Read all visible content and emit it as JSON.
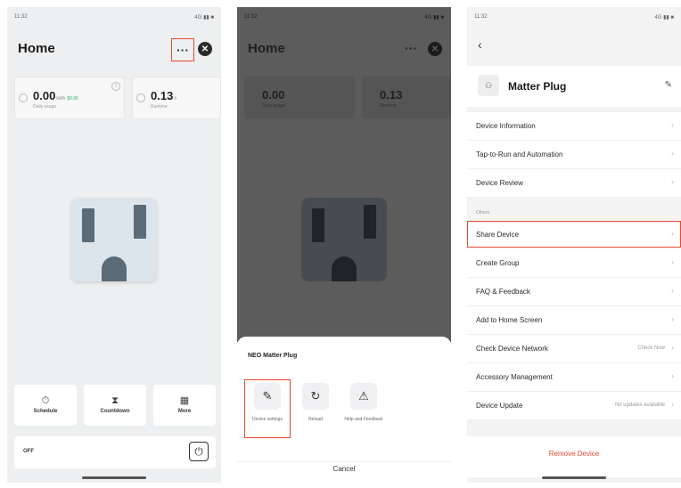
{
  "p1": {
    "status_time": "11:32",
    "status_icons": "4G ▮▮ ■",
    "title": "Home",
    "more_glyph": "···",
    "close_glyph": "✕",
    "stats": [
      {
        "value": "0.00",
        "unit": "kWh",
        "tag": "$0.00",
        "label": "Daily usage"
      },
      {
        "value": "0.13",
        "unit": "h",
        "tag": "",
        "label": "Runtime"
      }
    ],
    "info_glyph": "i",
    "actions": [
      {
        "icon": "⏱",
        "label": "Schedule"
      },
      {
        "icon": "⧗",
        "label": "Countdown"
      },
      {
        "icon": "▦",
        "label": "More"
      }
    ],
    "off_label": "OFF",
    "power_glyph": "⏻"
  },
  "p2": {
    "status_time": "11:32",
    "status_icons": "4G ▮▮ ■",
    "title": "Home",
    "more_glyph": "···",
    "close_glyph": "✕",
    "stats": [
      {
        "value": "0.00",
        "label": "Daily usage"
      },
      {
        "value": "0.13",
        "label": "Runtime"
      }
    ],
    "sheet_title": "NEO Matter Plug",
    "options": [
      {
        "icon": "✎",
        "label": "Device settings"
      },
      {
        "icon": "↻",
        "label": "Reload"
      },
      {
        "icon": "⚠",
        "label": "Help and Feedback"
      }
    ],
    "cancel": "Cancel"
  },
  "p3": {
    "status_time": "11:32",
    "status_icons": "4G ▮▮ ■",
    "back_glyph": "‹",
    "device_icon": "⚇",
    "device_name": "Matter Plug",
    "edit_glyph": "✎",
    "chevron": "›",
    "group1": [
      {
        "label": "Device Information"
      },
      {
        "label": "Tap-to-Run and Automation"
      },
      {
        "label": "Device Review"
      }
    ],
    "section_label": "Others",
    "group2": [
      {
        "label": "Share Device",
        "value": ""
      },
      {
        "label": "Create Group",
        "value": ""
      },
      {
        "label": "FAQ & Feedback",
        "value": ""
      },
      {
        "label": "Add to Home Screen",
        "value": ""
      },
      {
        "label": "Check Device Network",
        "value": "Check Now"
      },
      {
        "label": "Accessory Management",
        "value": ""
      },
      {
        "label": "Device Update",
        "value": "No updates available"
      }
    ],
    "remove": "Remove Device"
  },
  "colors": {
    "highlight": "#e8492f",
    "dim_overlay": "#5c5c5c",
    "outlet": "#dce4ec",
    "usage_tag": "#2fae5b"
  }
}
